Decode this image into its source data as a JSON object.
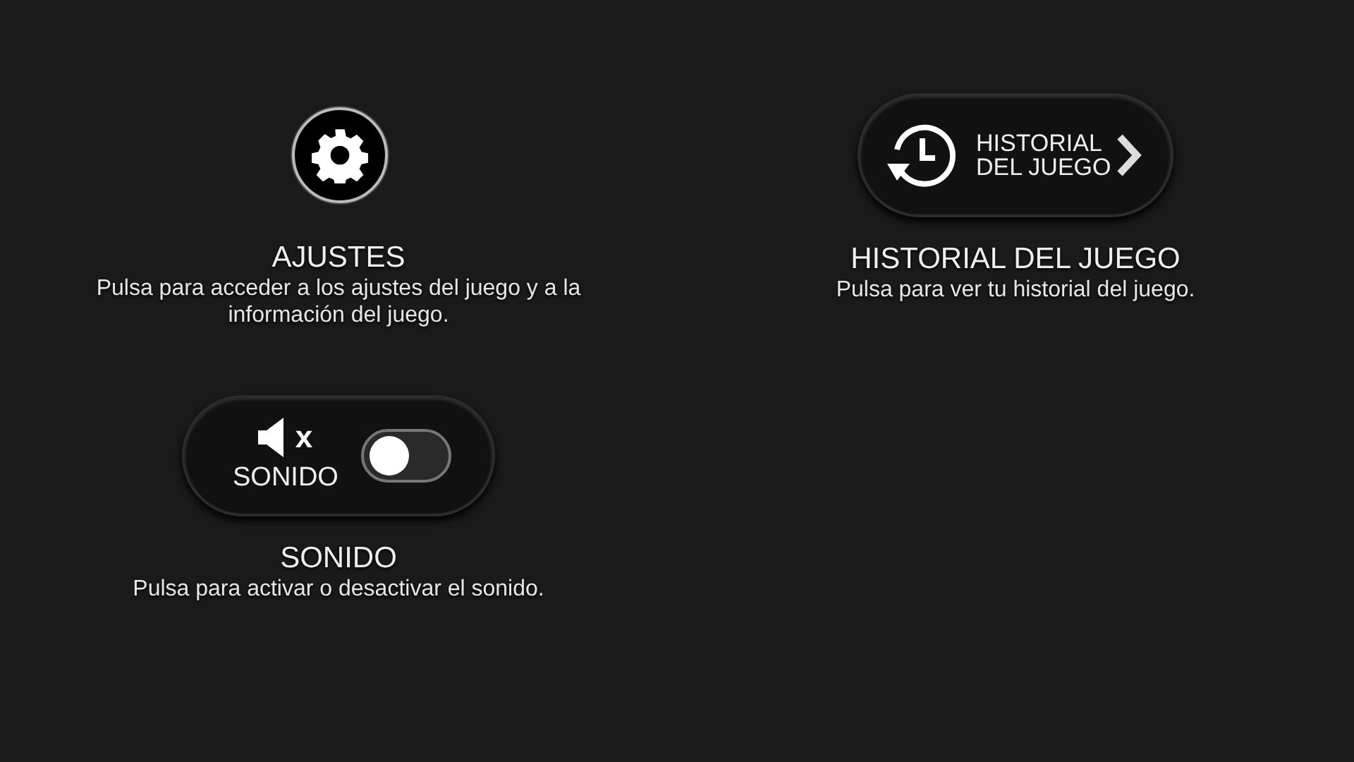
{
  "settings": {
    "title": "AJUSTES",
    "description": "Pulsa para acceder a los ajustes del juego y a la información del juego."
  },
  "sound": {
    "mute_mark": "x",
    "label": "SONIDO",
    "on": false,
    "title": "SONIDO",
    "description": "Pulsa para activar o desactivar el sonido."
  },
  "history": {
    "button_label": "HISTORIAL DEL JUEGO",
    "title": "HISTORIAL DEL JUEGO",
    "description": "Pulsa para ver tu historial del juego."
  }
}
